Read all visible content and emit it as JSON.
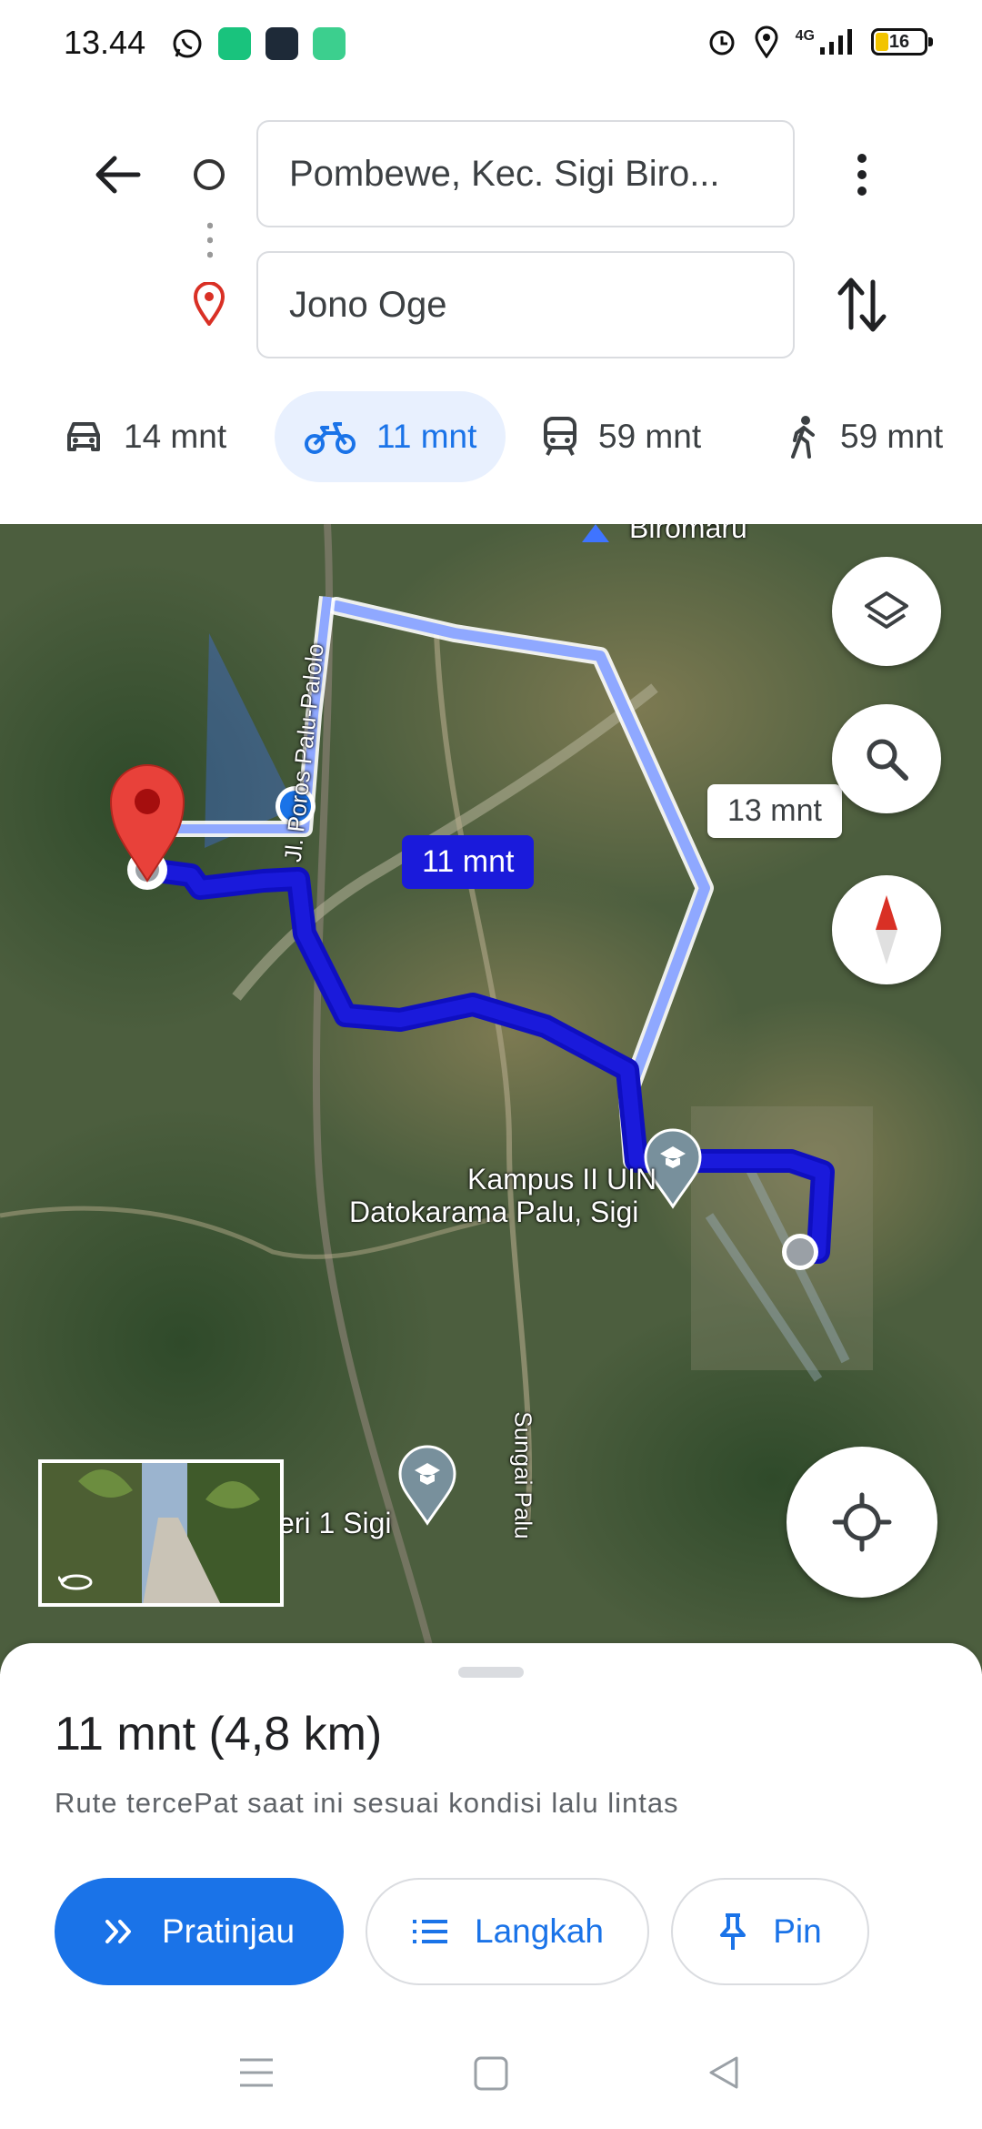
{
  "status_bar": {
    "time": "13.44",
    "network": "4G",
    "battery": "16",
    "icons": [
      "whatsapp-icon",
      "app-icon-green",
      "app-icon-dark",
      "phone-icon",
      "alarm-icon",
      "location-icon",
      "signal-icon",
      "battery-icon"
    ]
  },
  "directions": {
    "origin": "Pombewe, Kec. Sigi Biro...",
    "destination": "Jono Oge"
  },
  "modes": [
    {
      "name": "car",
      "label": "14 mnt",
      "active": false
    },
    {
      "name": "motorcycle",
      "label": "11 mnt",
      "active": true
    },
    {
      "name": "transit",
      "label": "59 mnt",
      "active": false
    },
    {
      "name": "walk",
      "label": "59 mnt",
      "active": false
    }
  ],
  "map": {
    "top_place": "Biromaru",
    "road_label": "Jl. Poros Palu-Palolo",
    "campus_label_1": "Kampus II UIN",
    "campus_label_2": "Datokarama Palu, Sigi",
    "school_label": "eri 1 Sigi",
    "river_label": "Sungai Palu",
    "alt_route_time": "13 mnt",
    "main_route_time": "11 mnt",
    "colors": {
      "route": "#1a1adb",
      "alt_route": "#8fa8ff",
      "pin": "#d93025"
    }
  },
  "sheet": {
    "summary": "11 mnt (4,8 km)",
    "subtitle": "Rute tercePat saat ini sesuai kondisi lalu lintas",
    "preview_label": "Pratinjau",
    "steps_label": "Langkah",
    "pin_label": "Pin"
  },
  "accent_color": "#1a73e8"
}
